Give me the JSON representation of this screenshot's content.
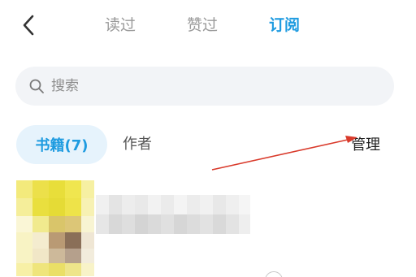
{
  "nav": {
    "tabs": [
      {
        "label": "读过",
        "active": false
      },
      {
        "label": "赞过",
        "active": false
      },
      {
        "label": "订阅",
        "active": true
      }
    ]
  },
  "search": {
    "placeholder": "搜索",
    "value": ""
  },
  "filters": {
    "books": {
      "label": "书籍(7)",
      "active": true
    },
    "authors": {
      "label": "作者",
      "active": false
    }
  },
  "manage_label": "管理",
  "colors": {
    "accent": "#1e9be0",
    "chip_bg": "#e6f3fc",
    "search_bg": "#f2f4f7",
    "annotation_arrow": "#d93a2b"
  },
  "icons": {
    "back": "chevron-left-icon",
    "search": "search-icon"
  }
}
